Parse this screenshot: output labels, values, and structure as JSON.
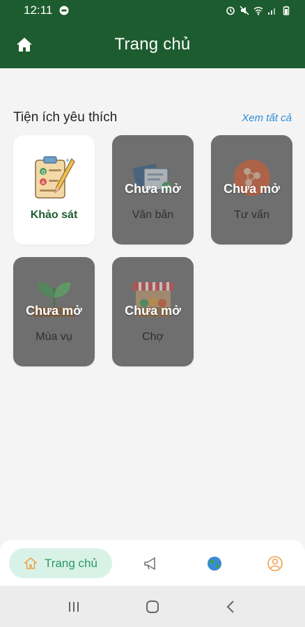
{
  "status_bar": {
    "time": "12:11"
  },
  "header": {
    "title": "Trang chủ"
  },
  "favorites": {
    "title": "Tiện ích yêu thích",
    "see_all": "Xem tất cả",
    "tiles": [
      {
        "label": "Khảo sát",
        "locked": false,
        "icon": "survey-icon"
      },
      {
        "label": "Văn bản",
        "locked": true,
        "lock_text": "Chưa mở",
        "icon": "documents-icon"
      },
      {
        "label": "Tư vấn",
        "locked": true,
        "lock_text": "Chưa mở",
        "icon": "consult-icon"
      },
      {
        "label": "Mùa vụ",
        "locked": true,
        "lock_text": "Chưa mở",
        "icon": "crop-season-icon"
      },
      {
        "label": "Chợ",
        "locked": true,
        "lock_text": "Chưa mở",
        "icon": "market-icon"
      }
    ]
  },
  "bottom_nav": {
    "home_label": "Trang chủ",
    "items": [
      "home-icon",
      "megaphone-icon",
      "globe-icon",
      "profile-icon"
    ]
  },
  "colors": {
    "primary": "#1d5c2e",
    "accent": "#2a9a63",
    "link": "#2a8bd6",
    "locked_overlay": "#6f6f6f"
  }
}
